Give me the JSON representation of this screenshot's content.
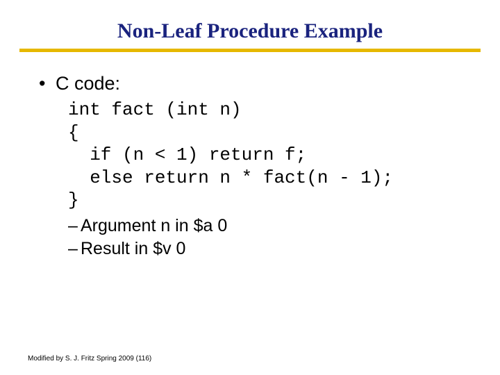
{
  "title": "Non-Leaf Procedure Example",
  "bullet": {
    "marker": "•",
    "text": "C code:"
  },
  "code": "int fact (int n)\n{ \n  if (n < 1) return f;\n  else return n * fact(n - 1);\n}",
  "sub": [
    {
      "marker": "–",
      "text": "Argument n in $a 0"
    },
    {
      "marker": "–",
      "text": "Result in $v 0"
    }
  ],
  "footer": "Modified by S. J. Fritz  Spring 2009 (116)"
}
